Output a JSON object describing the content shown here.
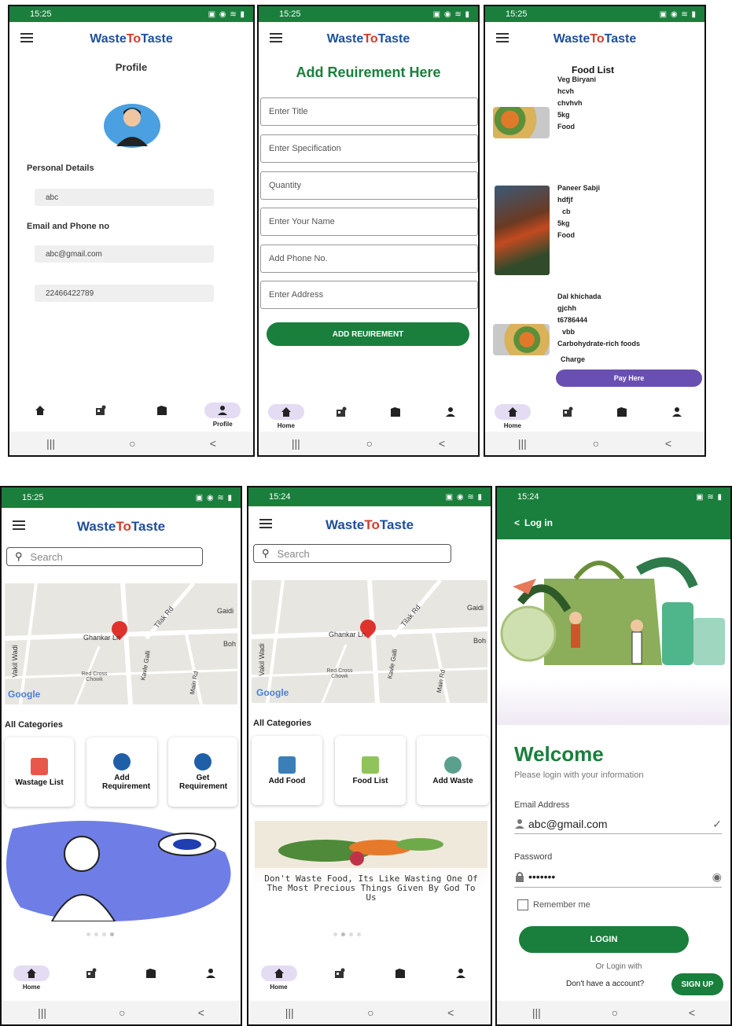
{
  "status_times": [
    "15:25",
    "15:25",
    "15:25",
    "15:25",
    "15:24",
    "15:24"
  ],
  "brand": {
    "w": "Waste",
    "to": "To",
    "t": "Taste"
  },
  "nav": {
    "home": "Home",
    "profile": "Profile"
  },
  "sysnav": {
    "recents": "|||",
    "home": "○",
    "back": "<"
  },
  "profile": {
    "title": "Profile",
    "personal_label": "Personal Details",
    "name_value": "abc",
    "contact_label": "Email and Phone no",
    "email_value": "abc@gmail.com",
    "phone_value": "22466422789"
  },
  "requirement": {
    "title": "Add Reuirement Here",
    "fields": [
      "Enter Title",
      "Enter Specification",
      "Quantity",
      "Enter Your Name",
      "Add Phone No.",
      "Enter Address"
    ],
    "button": "ADD REUIREMENT"
  },
  "foodlist": {
    "title": "Food List",
    "items": [
      {
        "lines": [
          "Veg Biryani",
          "hcvh",
          "chvhvh",
          "5kg",
          "Food"
        ]
      },
      {
        "lines": [
          "Paneer Sabji",
          "hdfjf",
          "cb",
          "5kg",
          "Food"
        ]
      },
      {
        "lines": [
          "Dal khichada",
          "gjchh",
          "t6786444",
          "vbb",
          "Carbohydrate-rich foods"
        ]
      }
    ],
    "charge_label": "Charge",
    "pay_button": "Pay Here"
  },
  "home1": {
    "search_placeholder": "Search",
    "categories_label": "All Categories",
    "categories": [
      "Wastage List",
      "Add Requirement",
      "Get Requirement"
    ],
    "map_labels": [
      "Ghankar Ln",
      "Tilak Rd",
      "Gaidi",
      "Boh",
      "Vakil Wadi",
      "Red Cross Chowk",
      "Kavle Galli",
      "Main Rd",
      "Google"
    ]
  },
  "home2": {
    "search_placeholder": "Search",
    "categories_label": "All Categories",
    "categories": [
      "Add Food",
      "Food List",
      "Add Waste"
    ],
    "banner_text": "Don't Waste Food, Its Like Wasting One Of The Most Precious Things Given By God To Us",
    "map_labels": [
      "Ghankar Ln",
      "Tilak Rd",
      "Gaidi",
      "Boh",
      "Vakil Wadi",
      "Red Cross Chowk",
      "Kavle Galli",
      "Main Rd",
      "Google"
    ]
  },
  "login": {
    "header": "Log in",
    "welcome": "Welcome",
    "subtitle": "Please login with your information",
    "email_label": "Email Address",
    "email_value": "abc@gmail.com",
    "password_label": "Password",
    "password_value": "•••••••",
    "remember": "Remember me",
    "login_button": "LOGIN",
    "or_login": "Or Login with",
    "no_account": "Don't have a account?",
    "signup_button": "SIGN UP"
  },
  "colors": {
    "green": "#1a7f3c",
    "purple": "#6a4fb3",
    "brand_blue": "#1f4f9a",
    "brand_red": "#d23b2f"
  }
}
